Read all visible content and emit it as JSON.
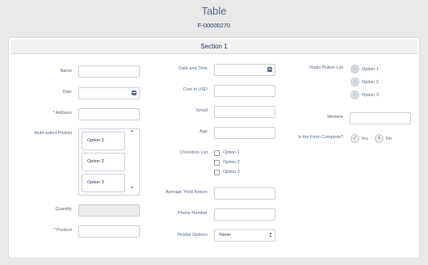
{
  "header": {
    "title": "Table",
    "record_id": "F-00000270"
  },
  "section": {
    "title": "Section 1"
  },
  "col1": {
    "name_label": "Name",
    "date_label": "Date",
    "address_required": "*",
    "address_label": "Address",
    "multiselect_label": "Multi-select Picklist",
    "multiselect_options": [
      "Option 1",
      "Option 2",
      "Option 3"
    ],
    "quantity_label": "Quantity",
    "product_required": "*",
    "product_label": "Product"
  },
  "col2": {
    "datetime_label": "Date and Time",
    "cost_label": "Cost in USD",
    "email_label": "Email",
    "age_label": "Age",
    "checkbox_label": "Checkbox List",
    "checkbox_options": [
      "Option 1",
      "Option 2",
      "Option 3"
    ],
    "yield_label": "Average Yield Return",
    "phone_label": "Phone Number",
    "picklist_label": "Picklist Options",
    "picklist_value": "-None-"
  },
  "col3": {
    "radio_label": "Radio Button List",
    "radio_options": [
      "Option 1",
      "Option 2",
      "Option 3"
    ],
    "website_label": "Website",
    "complete_label": "Is the Form Complete?",
    "yes_label": "Yes",
    "no_label": "No"
  },
  "icons": {
    "calendar": "calendar-icon",
    "chevron_up": "chevron-up-icon",
    "chevron_down": "chevron-down-icon",
    "check": "check-icon",
    "close": "close-icon"
  }
}
